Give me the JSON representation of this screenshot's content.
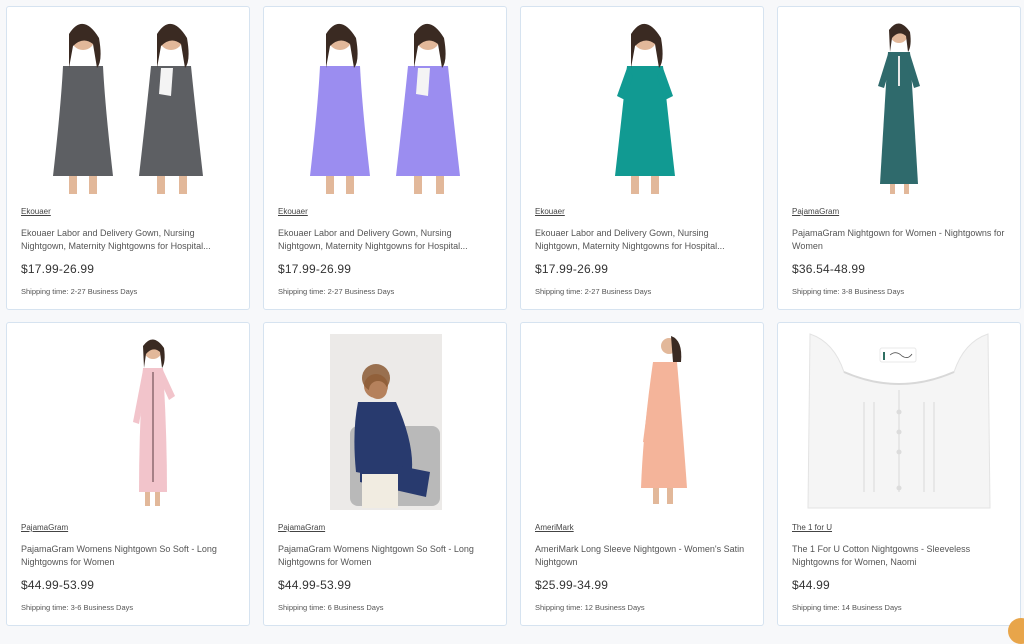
{
  "products": [
    {
      "brand": "Ekouaer",
      "title": "Ekouaer Labor and Delivery Gown, Nursing Nightgown, Maternity Nightgowns for Hospital...",
      "price": "$17.99-26.99",
      "shipping": "Shipping time: 2-27 Business Days",
      "image": "two-models-grey-maternity-gown",
      "color": "#5d5f63"
    },
    {
      "brand": "Ekouaer",
      "title": "Ekouaer Labor and Delivery Gown, Nursing Nightgown, Maternity Nightgowns for Hospital...",
      "price": "$17.99-26.99",
      "shipping": "Shipping time: 2-27 Business Days",
      "image": "two-models-lavender-maternity-gown",
      "color": "#9b8df0"
    },
    {
      "brand": "Ekouaer",
      "title": "Ekouaer Labor and Delivery Gown, Nursing Nightgown, Maternity Nightgowns for Hospital...",
      "price": "$17.99-26.99",
      "shipping": "Shipping time: 2-27 Business Days",
      "image": "model-teal-maternity-gown",
      "color": "#119a92"
    },
    {
      "brand": "PajamaGram",
      "title": "PajamaGram Nightgown for Women - Nightgowns for Women",
      "price": "$36.54-48.99",
      "shipping": "Shipping time: 3-8 Business Days",
      "image": "model-teal-long-nightgown",
      "color": "#2f6a6c"
    },
    {
      "brand": "PajamaGram",
      "title": "PajamaGram Womens Nightgown So Soft - Long Nightgowns for Women",
      "price": "$44.99-53.99",
      "shipping": "Shipping time: 3-6 Business Days",
      "image": "model-pink-long-nightgown",
      "color": "#f2c4cb"
    },
    {
      "brand": "PajamaGram",
      "title": "PajamaGram Womens Nightgown So Soft - Long Nightgowns for Women",
      "price": "$44.99-53.99",
      "shipping": "Shipping time: 6 Business Days",
      "image": "model-navy-nightgown-on-sofa",
      "color": "#283a6e"
    },
    {
      "brand": "AmeriMark",
      "title": "AmeriMark Long Sleeve Nightgown - Women's Satin Nightgown",
      "price": "$25.99-34.99",
      "shipping": "Shipping time: 12 Business Days",
      "image": "model-peach-satin-nightgown",
      "color": "#f4b49a"
    },
    {
      "brand": "The 1 for U",
      "title": "The 1 For U Cotton Nightgowns - Sleeveless Nightgowns for Women, Naomi",
      "price": "$44.99",
      "shipping": "Shipping time: 14 Business Days",
      "image": "white-cotton-nightgown-closeup",
      "color": "#ffffff"
    }
  ]
}
